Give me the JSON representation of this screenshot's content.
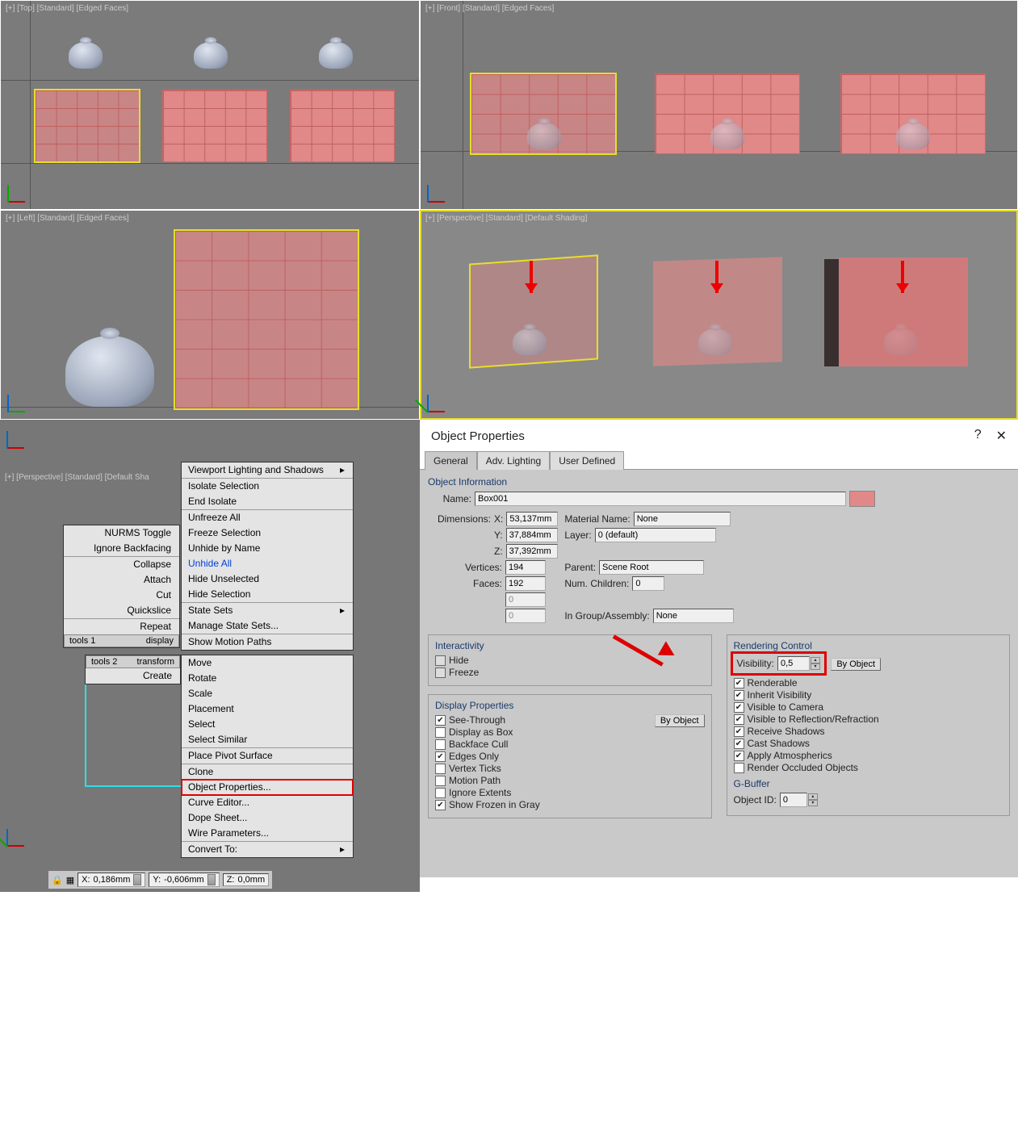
{
  "viewports": {
    "top": "[+] [Top] [Standard] [Edged Faces]",
    "front": "[+] [Front] [Standard] [Edged Faces]",
    "left": "[+] [Left] [Standard] [Edged Faces]",
    "persp": "[+] [Perspective] [Standard] [Default Shading]",
    "persp2": "[+] [Perspective] [Standard] [Default Sha"
  },
  "ctx_menu_left": {
    "items": [
      "NURMS Toggle",
      "Ignore Backfacing",
      "Collapse",
      "Attach",
      "Cut",
      "Quickslice",
      "Repeat"
    ],
    "footer_left": "tools 1",
    "footer_right": "display"
  },
  "ctx_menu_mid": {
    "hdr_left": "tools 2",
    "hdr_right": "transform",
    "items": [
      "Create",
      "Move",
      "Rotate",
      "Scale",
      "Placement",
      "Select",
      "Select Similar"
    ],
    "items2": [
      "Place Pivot Surface",
      "Clone",
      "Object Properties...",
      "Curve Editor...",
      "Dope Sheet...",
      "Wire Parameters...",
      "Convert To:"
    ]
  },
  "ctx_menu_right": {
    "items": [
      "Viewport Lighting and Shadows",
      "Isolate Selection",
      "End Isolate",
      "Unfreeze All",
      "Freeze Selection",
      "Unhide by Name",
      "Unhide All",
      "Hide Unselected",
      "Hide Selection",
      "State Sets",
      "Manage State Sets...",
      "Show Motion Paths"
    ]
  },
  "status": {
    "x_lab": "X:",
    "x": "0,186mm",
    "y_lab": "Y:",
    "y": "-0,606mm",
    "z_lab": "Z:",
    "z": "0,0mm"
  },
  "dlg": {
    "title": "Object Properties",
    "help": "?",
    "close": "✕",
    "tabs": [
      "General",
      "Adv. Lighting",
      "User Defined"
    ],
    "info_t": "Object Information",
    "name_l": "Name:",
    "name": "Box001",
    "dim_l": "Dimensions:",
    "x_l": "X:",
    "x": "53,137mm",
    "y_l": "Y:",
    "y": "37,884mm",
    "z_l": "Z:",
    "z": "37,392mm",
    "mat_l": "Material Name:",
    "mat": "None",
    "layer_l": "Layer:",
    "layer": "0 (default)",
    "vert_l": "Vertices:",
    "vert": "194",
    "faces_l": "Faces:",
    "faces": "192",
    "parent_l": "Parent:",
    "parent": "Scene Root",
    "child_l": "Num. Children:",
    "child": "0",
    "blank1": "0",
    "blank2": "0",
    "group_l": "In Group/Assembly:",
    "group": "None",
    "inter_t": "Interactivity",
    "hide": "Hide",
    "freeze": "Freeze",
    "disp_t": "Display Properties",
    "by_obj": "By Object",
    "dp": [
      "See-Through",
      "Display as Box",
      "Backface Cull",
      "Edges Only",
      "Vertex Ticks",
      "Motion Path",
      "Ignore Extents",
      "Show Frozen in Gray"
    ],
    "dp_chk": [
      true,
      false,
      false,
      true,
      false,
      false,
      false,
      true
    ],
    "rc_t": "Rendering Control",
    "vis_l": "Visibility:",
    "vis": "0,5",
    "rc": [
      "Renderable",
      "Inherit Visibility",
      "Visible to Camera",
      "Visible to Reflection/Refraction",
      "Receive Shadows",
      "Cast Shadows",
      "Apply Atmospherics",
      "Render Occluded Objects"
    ],
    "rc_chk": [
      true,
      true,
      true,
      true,
      true,
      true,
      true,
      false
    ],
    "gb_t": "G-Buffer",
    "oid_l": "Object ID:",
    "oid": "0"
  }
}
